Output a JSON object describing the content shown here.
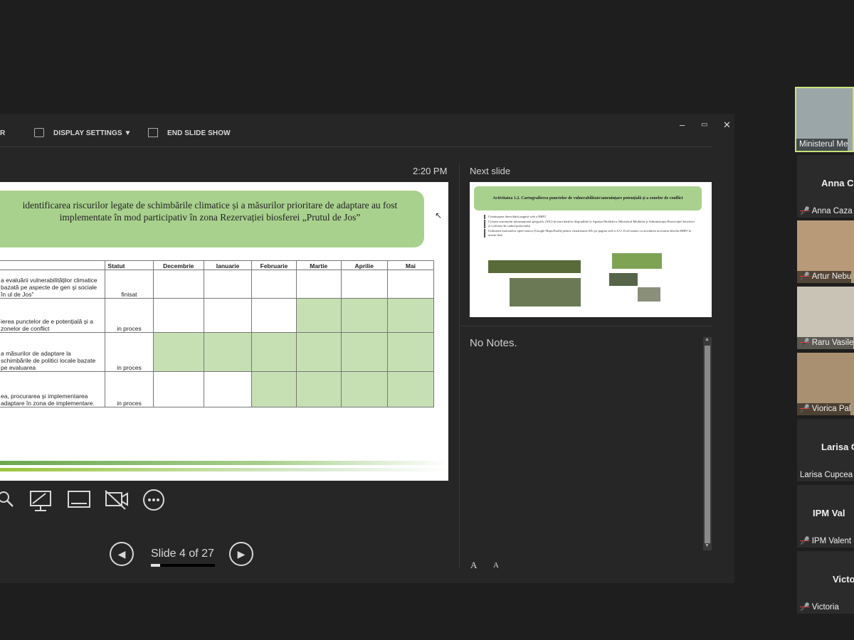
{
  "toolbar": {
    "partial_label": "R",
    "display_settings": "DISPLAY SETTINGS ▼",
    "end_show": "END SLIDE SHOW"
  },
  "window": {
    "minimize": "–",
    "restore": "▭",
    "close": "✕"
  },
  "clock": "2:20 PM",
  "next_slide_label": "Next slide",
  "slide": {
    "title": "identificarea riscurilor legate de schimbările climatice și a măsurilor prioritare de adaptare au fost implementate în mod participativ în zona Rezervației biosferei „Prutul de Jos”",
    "columns": [
      "",
      "Statut",
      "Decembrie",
      "Ianuarie",
      "Februarie",
      "Martie",
      "Aprilie",
      "Mai"
    ],
    "rows": [
      {
        "task": "a evaluării vulnerabilităților climatice bazată pe aspecte de gen și sociale în ul de Jos”",
        "status": "finisat",
        "green": [
          0,
          0,
          0,
          0,
          0,
          0
        ]
      },
      {
        "task": "ierea punctelor de e potențială și a zonelor de conflict",
        "status": "in proces",
        "green": [
          0,
          0,
          0,
          1,
          1,
          1
        ]
      },
      {
        "task": "a măsurilor de adaptare la schimbările de politici locale bazate pe evaluarea",
        "status": "in proces",
        "green": [
          1,
          1,
          1,
          1,
          1,
          1
        ]
      },
      {
        "task": "ea, procurarea și implementarea adaptare în zona de implementare.",
        "status": "in proces",
        "green": [
          0,
          0,
          1,
          1,
          1,
          1
        ]
      }
    ]
  },
  "next_slide": {
    "title": "Activitatea 1.2. Cartografierea punctelor de vulnerabilitate/amenințare potențială și a zonelor de conflict",
    "bullets": [
      "Continuarea dezvoltării paginii web a RBPJ",
      "Crearea sistemului informațional geografic (SIG) în baza hărților disponibile la Agenția Moldsilva, Ministerul Mediului și Administrația Rezervației biosferei și colectate în cadrul proiectului",
      "Utilizarea motoarelor open-source (Google Maps/Earth) pentru vizualizarea SIG pe pagina web a A.O. EcoContact cu acordarea accesului deschis RBPJ la aceste date"
    ]
  },
  "notes": "No Notes.",
  "navigation": {
    "slide_counter": "Slide 4 of 27",
    "prev": "◀",
    "next": "▶",
    "progress": 0.148
  },
  "font_controls": {
    "increase": "A",
    "decrease": "A"
  },
  "participants": [
    {
      "name": "Ministerul Me",
      "muted": false
    },
    {
      "display": "Anna C",
      "name": "Anna Caza",
      "muted": true
    },
    {
      "name": "Artur Nebu",
      "muted": true
    },
    {
      "name": "Raru Vasile",
      "muted": true
    },
    {
      "name": "Viorica Pal",
      "muted": true
    },
    {
      "display": "Larisa C",
      "name": "Larisa Cupcea",
      "muted": false
    },
    {
      "display": "IPM  Val",
      "name": "IPM Valent",
      "muted": true
    },
    {
      "display": "Victo",
      "name": "Victoria",
      "muted": true
    }
  ],
  "colors": {
    "accent_green": "#a9d18e",
    "cell_green": "#c6e0b4",
    "active_speaker": "#c8e37a",
    "mute_red": "#e04040"
  }
}
